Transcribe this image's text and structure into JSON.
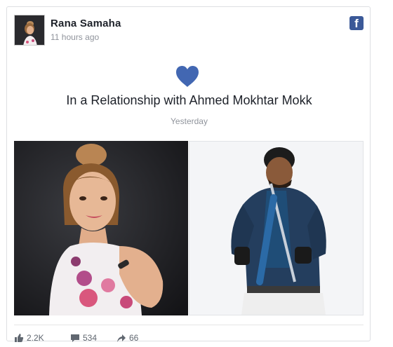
{
  "post": {
    "author": "Rana Samaha",
    "time": "11 hours ago",
    "platform_icon": "facebook-icon",
    "event_icon": "heart-icon",
    "event_text": "In a Relationship with Ahmed Mokhtar Mokk",
    "event_when": "Yesterday"
  },
  "photos": [
    {
      "name": "woman-portrait"
    },
    {
      "name": "man-violin-portrait"
    }
  ],
  "stats": {
    "likes": "2.2K",
    "comments": "534",
    "shares": "66"
  },
  "colors": {
    "facebook_blue": "#3b5998",
    "heart": "#4267b2",
    "muted_text": "#90949c"
  }
}
